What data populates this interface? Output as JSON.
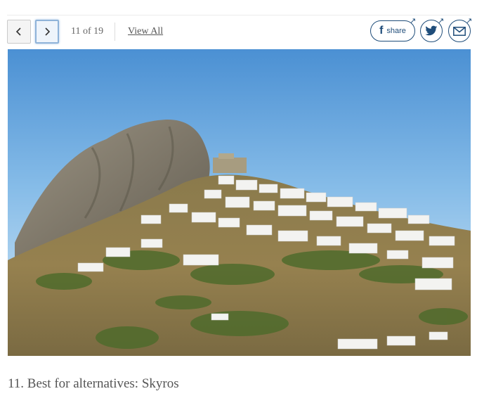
{
  "gallery": {
    "current": 11,
    "total": 19,
    "counter_text": "11 of 19",
    "view_all_label": "View All"
  },
  "share": {
    "share_label": "share",
    "brand_color": "#1f4d7a",
    "icons": [
      "facebook-icon",
      "twitter-icon",
      "email-icon"
    ]
  },
  "slide": {
    "caption": "11. Best for alternatives: Skyros"
  },
  "icons": {
    "prev": "chevron-left-icon",
    "next": "chevron-right-icon"
  }
}
